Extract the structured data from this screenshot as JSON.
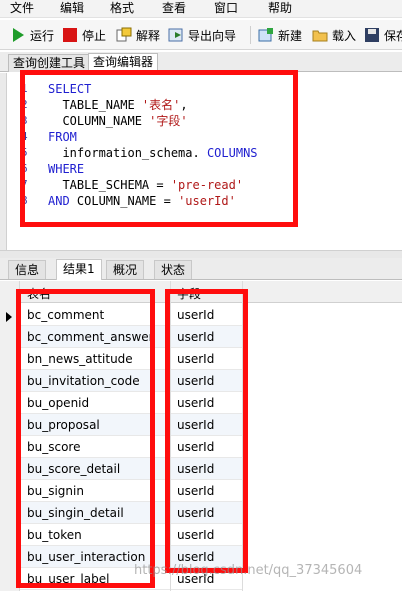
{
  "menu": [
    "文件",
    "编辑",
    "格式",
    "查看",
    "窗口",
    "帮助"
  ],
  "toolbar": {
    "run": "运行",
    "stop": "停止",
    "explain": "解释",
    "export_wizard": "导出向导",
    "new": "新建",
    "load": "载入",
    "save": "保存"
  },
  "editor_tabs": [
    "查询创建工具",
    "查询编辑器"
  ],
  "sql_lines": [
    {
      "n": "1",
      "kw": "SELECT",
      "rest": ""
    },
    {
      "n": "2",
      "kw": "",
      "rest": "  TABLE_NAME ",
      "str": "'表名'",
      "tail": ","
    },
    {
      "n": "3",
      "kw": "",
      "rest": "  COLUMN_NAME ",
      "str": "'字段'",
      "tail": ""
    },
    {
      "n": "4",
      "kw": "FROM",
      "rest": ""
    },
    {
      "n": "5",
      "kw": "",
      "rest": "  information_schema.",
      "kw2": " COLUMNS"
    },
    {
      "n": "6",
      "kw": "WHERE",
      "rest": ""
    },
    {
      "n": "7",
      "kw": "",
      "rest": "  TABLE_SCHEMA = ",
      "str": "'pre-read'",
      "tail": ""
    },
    {
      "n": "8",
      "kw": "AND",
      "rest": " COLUMN_NAME = ",
      "str": "'userId'",
      "tail": ""
    }
  ],
  "result_tabs": [
    "信息",
    "结果1",
    "概况",
    "状态"
  ],
  "grid": {
    "headers": [
      "表名",
      "字段"
    ],
    "rows": [
      [
        "bc_comment",
        "userId"
      ],
      [
        "bc_comment_answer",
        "userId"
      ],
      [
        "bn_news_attitude",
        "userId"
      ],
      [
        "bu_invitation_code",
        "userId"
      ],
      [
        "bu_openid",
        "userId"
      ],
      [
        "bu_proposal",
        "userId"
      ],
      [
        "bu_score",
        "userId"
      ],
      [
        "bu_score_detail",
        "userId"
      ],
      [
        "bu_signin",
        "userId"
      ],
      [
        "bu_singin_detail",
        "userId"
      ],
      [
        "bu_token",
        "userId"
      ],
      [
        "bu_user_interaction",
        "userId"
      ],
      [
        "bu_user_label",
        "userId"
      ]
    ]
  },
  "watermark": "https://blog.csdn.net/qq_37345604",
  "colors": {
    "annotation": "#ff0d0d",
    "keyword": "#1f1fd0",
    "string": "#b01818"
  }
}
